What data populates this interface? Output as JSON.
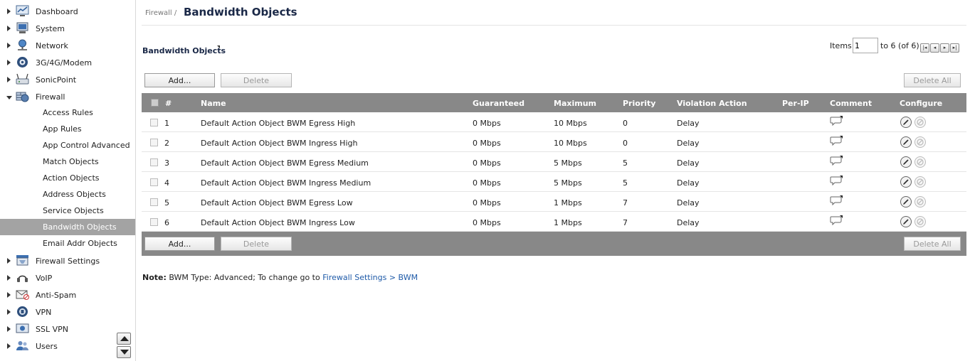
{
  "sidebar": {
    "items": [
      {
        "label": "Dashboard",
        "icon": "dashboard-icon"
      },
      {
        "label": "System",
        "icon": "system-icon"
      },
      {
        "label": "Network",
        "icon": "network-icon"
      },
      {
        "label": "3G/4G/Modem",
        "icon": "modem-icon"
      },
      {
        "label": "SonicPoint",
        "icon": "sonicpoint-icon"
      },
      {
        "label": "Firewall",
        "icon": "firewall-icon",
        "expanded": true
      },
      {
        "label": "Firewall Settings",
        "icon": "firewall-settings-icon"
      },
      {
        "label": "VoIP",
        "icon": "voip-icon"
      },
      {
        "label": "Anti-Spam",
        "icon": "anti-spam-icon"
      },
      {
        "label": "VPN",
        "icon": "vpn-icon"
      },
      {
        "label": "SSL VPN",
        "icon": "ssl-vpn-icon"
      },
      {
        "label": "Users",
        "icon": "users-icon"
      }
    ],
    "firewall_children": [
      {
        "label": "Access Rules"
      },
      {
        "label": "App Rules"
      },
      {
        "label": "App Control Advanced"
      },
      {
        "label": "Match Objects"
      },
      {
        "label": "Action Objects"
      },
      {
        "label": "Address Objects"
      },
      {
        "label": "Service Objects"
      },
      {
        "label": "Bandwidth Objects",
        "active": true
      },
      {
        "label": "Email Addr Objects"
      }
    ]
  },
  "header": {
    "breadcrumb_parent": "Firewall /",
    "title": "Bandwidth Objects"
  },
  "section": {
    "title": "Bandwidth Objects"
  },
  "pagination": {
    "items_label": "Items",
    "items_value": "1",
    "range_text": "to 6 (of 6)"
  },
  "buttons": {
    "add": "Add...",
    "delete": "Delete",
    "delete_all": "Delete All"
  },
  "table": {
    "columns": [
      "#",
      "Name",
      "Guaranteed",
      "Maximum",
      "Priority",
      "Violation Action",
      "Per-IP",
      "Comment",
      "Configure"
    ],
    "rows": [
      {
        "num": "1",
        "name": "Default Action Object BWM Egress High",
        "guaranteed": "0 Mbps",
        "maximum": "10 Mbps",
        "priority": "0",
        "violation": "Delay"
      },
      {
        "num": "2",
        "name": "Default Action Object BWM Ingress High",
        "guaranteed": "0 Mbps",
        "maximum": "10 Mbps",
        "priority": "0",
        "violation": "Delay"
      },
      {
        "num": "3",
        "name": "Default Action Object BWM Egress Medium",
        "guaranteed": "0 Mbps",
        "maximum": "5 Mbps",
        "priority": "5",
        "violation": "Delay"
      },
      {
        "num": "4",
        "name": "Default Action Object BWM Ingress Medium",
        "guaranteed": "0 Mbps",
        "maximum": "5 Mbps",
        "priority": "5",
        "violation": "Delay"
      },
      {
        "num": "5",
        "name": "Default Action Object BWM Egress Low",
        "guaranteed": "0 Mbps",
        "maximum": "1 Mbps",
        "priority": "7",
        "violation": "Delay"
      },
      {
        "num": "6",
        "name": "Default Action Object BWM Ingress Low",
        "guaranteed": "0 Mbps",
        "maximum": "1 Mbps",
        "priority": "7",
        "violation": "Delay"
      }
    ]
  },
  "note": {
    "label": "Note:",
    "text": "BWM Type: Advanced; To change go to",
    "link": "Firewall Settings > BWM"
  },
  "colors": {
    "header_gray": "#888888",
    "active_nav": "#a3a3a3",
    "title_navy": "#1a2847",
    "link_blue": "#1e5aa8"
  }
}
